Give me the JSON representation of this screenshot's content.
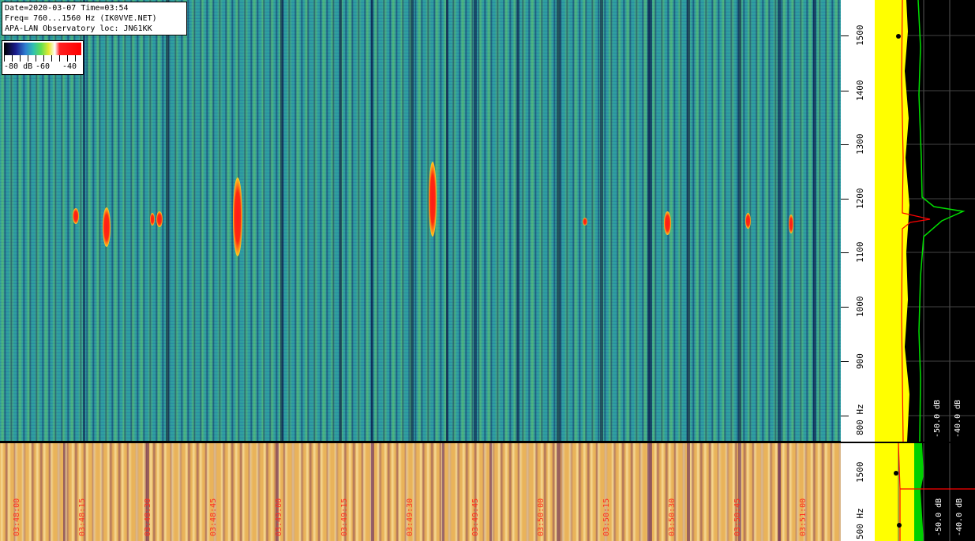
{
  "header": {
    "date_time": "Date=2020-03-07 Time=03:54",
    "freq": "Freq= 760...1560 Hz (IK0VVE.NET)",
    "observatory": "APA-LAN Observatory loc: JN61KK"
  },
  "colorbar": {
    "label_min": "-80 dB",
    "label_mid": "-60",
    "label_max": "-40"
  },
  "freq_axis_main": {
    "labels": [
      "1500",
      "1400",
      "1300",
      "1200",
      "1100",
      "1000",
      "900",
      "800 Hz"
    ]
  },
  "freq_axis_bottom": {
    "labels": [
      "1500",
      "500 Hz"
    ]
  },
  "spectrum_main": {
    "db_labels": [
      "-50.0 dB",
      "-40.0 dB"
    ]
  },
  "spectrum_bottom": {
    "db_labels": [
      "-50.0 dB",
      "-40.0 dB"
    ]
  },
  "time_labels": [
    "03:48:00",
    "03:48:15",
    "03:48:30",
    "03:48:45",
    "03:49:00",
    "03:49:15",
    "03:49:30",
    "03:49:45",
    "03:50:00",
    "03:50:15",
    "03:50:30",
    "03:50:45",
    "03:51:00"
  ],
  "colors": {
    "waterfall_base": "#2f9fa0",
    "bottom_base": "#e9b35a",
    "meteor_red": "#ff1a1a",
    "spectrum_yellow": "#ffff00",
    "spectrum_green": "#00e000",
    "spectrum_red": "#ff0000"
  }
}
